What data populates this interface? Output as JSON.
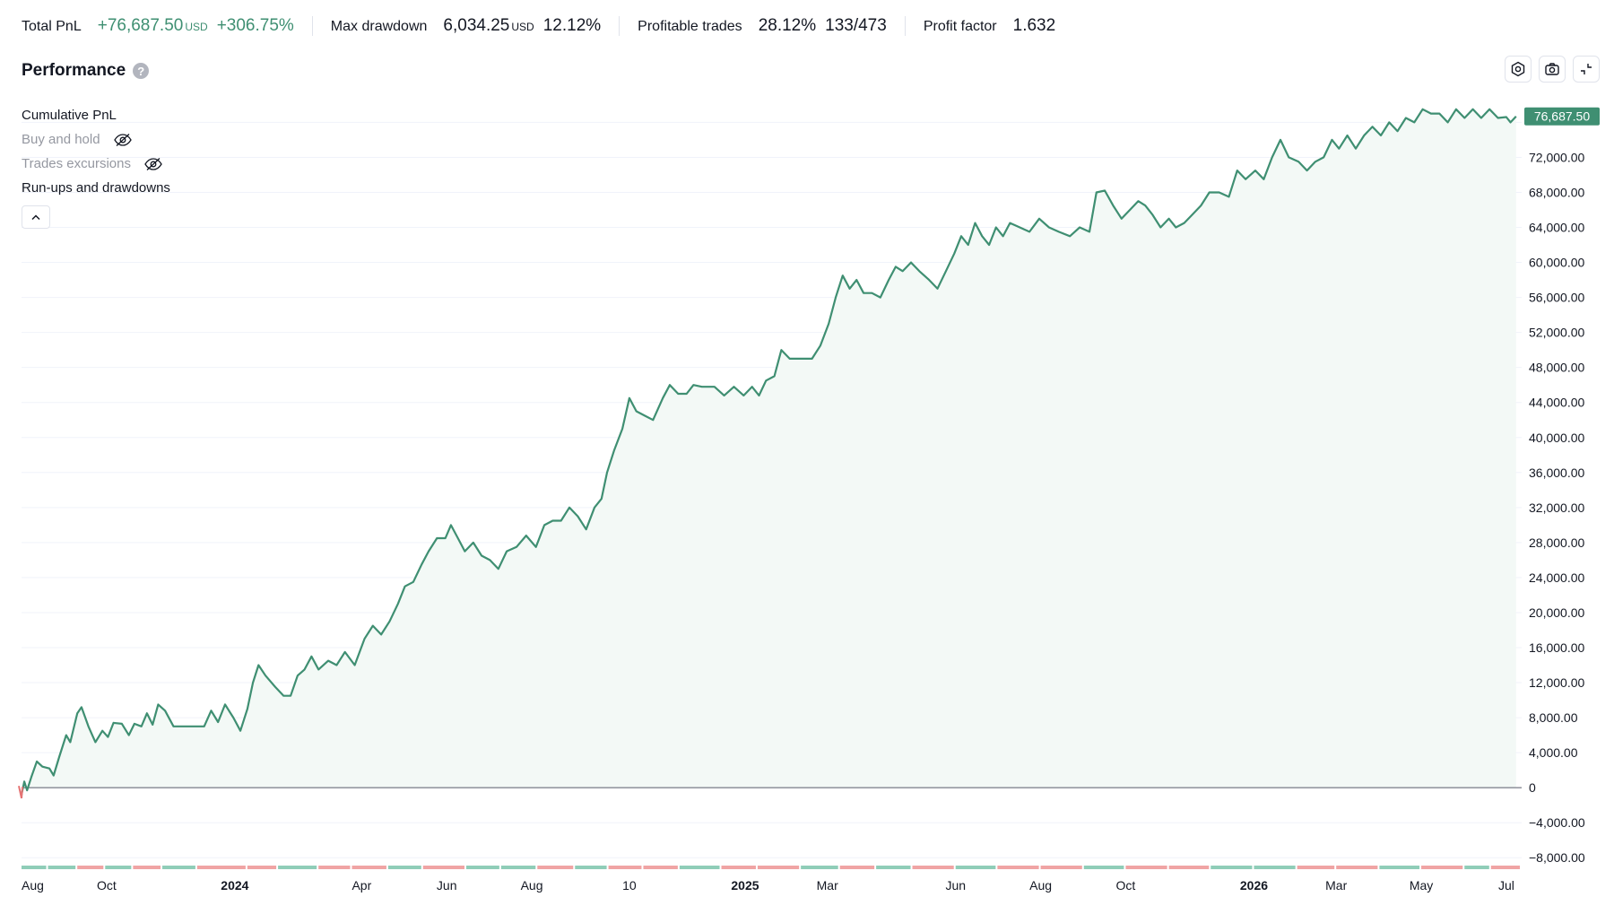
{
  "stats": {
    "total_pnl": {
      "label": "Total PnL",
      "value": "+76,687.50",
      "unit": "USD",
      "pct": "+306.75%"
    },
    "max_drawdown": {
      "label": "Max drawdown",
      "value": "6,034.25",
      "unit": "USD",
      "pct": "12.12%"
    },
    "profitable_trades": {
      "label": "Profitable trades",
      "pct": "28.12%",
      "count": "133/473"
    },
    "profit_factor": {
      "label": "Profit factor",
      "value": "1.632"
    }
  },
  "panel": {
    "title": "Performance",
    "help_icon": "question-icon",
    "toolbar_icons": [
      "settings-icon",
      "camera-icon",
      "collapse-icon"
    ]
  },
  "legend": {
    "cumulative": "Cumulative PnL",
    "buy_hold": "Buy and hold",
    "excursions": "Trades excursions",
    "runups": "Run-ups and drawdowns",
    "hidden_icon": "eye-off-icon",
    "collapse_icon": "chevron-up-icon"
  },
  "colors": {
    "accent": "#3f8f72",
    "fill": "#f3f9f6",
    "negative": "#e57373",
    "bar_green": "#8fcdb8",
    "bar_red": "#f0a4a4",
    "last_badge": "#3f8f72"
  },
  "chart_data": {
    "type": "area",
    "title": "",
    "xlabel": "",
    "ylabel": "",
    "ylim": [
      -9000,
      78500
    ],
    "grid": true,
    "y_ticks": [
      76000,
      72000,
      68000,
      64000,
      60000,
      56000,
      52000,
      48000,
      44000,
      40000,
      36000,
      32000,
      28000,
      24000,
      20000,
      16000,
      12000,
      8000,
      4000,
      0,
      -4000,
      -8000
    ],
    "y_tick_labels": [
      "76,000.00",
      "72,000.00",
      "68,000.00",
      "64,000.00",
      "60,000.00",
      "56,000.00",
      "52,000.00",
      "48,000.00",
      "44,000.00",
      "40,000.00",
      "36,000.00",
      "32,000.00",
      "28,000.00",
      "24,000.00",
      "20,000.00",
      "16,000.00",
      "12,000.00",
      "8,000.00",
      "4,000.00",
      "0",
      "−4,000.00",
      "−8,000.00"
    ],
    "x_ticks": [
      {
        "label": "Aug",
        "date": "2023-08-01",
        "bold": false
      },
      {
        "label": "Oct",
        "date": "2023-10-01",
        "bold": false
      },
      {
        "label": "2024",
        "date": "2024-01-01",
        "bold": true
      },
      {
        "label": "Apr",
        "date": "2024-04-01",
        "bold": false
      },
      {
        "label": "Jun",
        "date": "2024-06-01",
        "bold": false
      },
      {
        "label": "Aug",
        "date": "2024-08-01",
        "bold": false
      },
      {
        "label": "10",
        "date": "2024-10-10",
        "bold": false
      },
      {
        "label": "2025",
        "date": "2025-01-01",
        "bold": true
      },
      {
        "label": "Mar",
        "date": "2025-03-01",
        "bold": false
      },
      {
        "label": "Jun",
        "date": "2025-06-01",
        "bold": false
      },
      {
        "label": "Aug",
        "date": "2025-08-01",
        "bold": false
      },
      {
        "label": "Oct",
        "date": "2025-10-01",
        "bold": false
      },
      {
        "label": "2026",
        "date": "2026-01-01",
        "bold": true
      },
      {
        "label": "Mar",
        "date": "2026-03-01",
        "bold": false
      },
      {
        "label": "May",
        "date": "2026-05-01",
        "bold": false
      },
      {
        "label": "Jul",
        "date": "2026-07-01",
        "bold": false
      }
    ],
    "last_value_label": "76,687.50",
    "series": [
      {
        "name": "Cumulative PnL",
        "points": [
          [
            "2023-08-01",
            -800
          ],
          [
            "2023-08-03",
            700
          ],
          [
            "2023-08-05",
            -300
          ],
          [
            "2023-08-08",
            1200
          ],
          [
            "2023-08-12",
            3000
          ],
          [
            "2023-08-16",
            2400
          ],
          [
            "2023-08-21",
            2200
          ],
          [
            "2023-08-24",
            1400
          ],
          [
            "2023-08-28",
            3500
          ],
          [
            "2023-09-02",
            6000
          ],
          [
            "2023-09-05",
            5200
          ],
          [
            "2023-09-10",
            8500
          ],
          [
            "2023-09-13",
            9200
          ],
          [
            "2023-09-18",
            7000
          ],
          [
            "2023-09-23",
            5200
          ],
          [
            "2023-09-28",
            6500
          ],
          [
            "2023-10-02",
            5800
          ],
          [
            "2023-10-06",
            7400
          ],
          [
            "2023-10-12",
            7300
          ],
          [
            "2023-10-17",
            6000
          ],
          [
            "2023-10-21",
            7300
          ],
          [
            "2023-10-26",
            7000
          ],
          [
            "2023-10-30",
            8500
          ],
          [
            "2023-11-03",
            7200
          ],
          [
            "2023-11-07",
            9500
          ],
          [
            "2023-11-12",
            8800
          ],
          [
            "2023-11-18",
            7000
          ],
          [
            "2023-11-30",
            7000
          ],
          [
            "2023-12-10",
            7000
          ],
          [
            "2023-12-15",
            8800
          ],
          [
            "2023-12-20",
            7500
          ],
          [
            "2023-12-25",
            9500
          ],
          [
            "2023-12-31",
            8000
          ],
          [
            "2024-01-05",
            6500
          ],
          [
            "2024-01-10",
            9000
          ],
          [
            "2024-01-14",
            12000
          ],
          [
            "2024-01-18",
            14000
          ],
          [
            "2024-01-23",
            12800
          ],
          [
            "2024-01-30",
            11500
          ],
          [
            "2024-02-05",
            10500
          ],
          [
            "2024-02-10",
            10500
          ],
          [
            "2024-02-15",
            12800
          ],
          [
            "2024-02-20",
            13500
          ],
          [
            "2024-02-25",
            15000
          ],
          [
            "2024-03-01",
            13500
          ],
          [
            "2024-03-08",
            14500
          ],
          [
            "2024-03-14",
            14000
          ],
          [
            "2024-03-20",
            15500
          ],
          [
            "2024-03-27",
            14000
          ],
          [
            "2024-04-03",
            17000
          ],
          [
            "2024-04-09",
            18500
          ],
          [
            "2024-04-15",
            17500
          ],
          [
            "2024-04-21",
            19000
          ],
          [
            "2024-04-27",
            21000
          ],
          [
            "2024-05-02",
            23000
          ],
          [
            "2024-05-08",
            23500
          ],
          [
            "2024-05-14",
            25500
          ],
          [
            "2024-05-19",
            27000
          ],
          [
            "2024-05-25",
            28500
          ],
          [
            "2024-05-31",
            28500
          ],
          [
            "2024-06-04",
            30000
          ],
          [
            "2024-06-09",
            28500
          ],
          [
            "2024-06-14",
            27000
          ],
          [
            "2024-06-20",
            28000
          ],
          [
            "2024-06-26",
            26500
          ],
          [
            "2024-07-02",
            26000
          ],
          [
            "2024-07-08",
            25000
          ],
          [
            "2024-07-14",
            27000
          ],
          [
            "2024-07-21",
            27500
          ],
          [
            "2024-07-28",
            28800
          ],
          [
            "2024-08-04",
            27500
          ],
          [
            "2024-08-10",
            30000
          ],
          [
            "2024-08-16",
            30500
          ],
          [
            "2024-08-22",
            30500
          ],
          [
            "2024-08-28",
            32000
          ],
          [
            "2024-09-03",
            31000
          ],
          [
            "2024-09-09",
            29500
          ],
          [
            "2024-09-15",
            32000
          ],
          [
            "2024-09-20",
            33000
          ],
          [
            "2024-09-24",
            36000
          ],
          [
            "2024-09-29",
            38500
          ],
          [
            "2024-10-05",
            41000
          ],
          [
            "2024-10-10",
            44500
          ],
          [
            "2024-10-15",
            43000
          ],
          [
            "2024-10-21",
            42500
          ],
          [
            "2024-10-27",
            42000
          ],
          [
            "2024-11-03",
            44500
          ],
          [
            "2024-11-08",
            46000
          ],
          [
            "2024-11-14",
            45000
          ],
          [
            "2024-11-20",
            45000
          ],
          [
            "2024-11-25",
            46000
          ],
          [
            "2024-12-01",
            45800
          ],
          [
            "2024-12-10",
            45800
          ],
          [
            "2024-12-17",
            44800
          ],
          [
            "2024-12-24",
            45800
          ],
          [
            "2024-12-31",
            44800
          ],
          [
            "2025-01-06",
            45800
          ],
          [
            "2025-01-11",
            44800
          ],
          [
            "2025-01-16",
            46500
          ],
          [
            "2025-01-22",
            47000
          ],
          [
            "2025-01-27",
            50000
          ],
          [
            "2025-02-02",
            49000
          ],
          [
            "2025-02-10",
            49000
          ],
          [
            "2025-02-18",
            49000
          ],
          [
            "2025-02-24",
            50500
          ],
          [
            "2025-03-02",
            53000
          ],
          [
            "2025-03-07",
            56000
          ],
          [
            "2025-03-12",
            58500
          ],
          [
            "2025-03-17",
            57000
          ],
          [
            "2025-03-22",
            58000
          ],
          [
            "2025-03-27",
            56500
          ],
          [
            "2025-04-02",
            56500
          ],
          [
            "2025-04-08",
            56000
          ],
          [
            "2025-04-14",
            58000
          ],
          [
            "2025-04-19",
            59500
          ],
          [
            "2025-04-24",
            59000
          ],
          [
            "2025-04-30",
            60000
          ],
          [
            "2025-05-06",
            59000
          ],
          [
            "2025-05-13",
            58000
          ],
          [
            "2025-05-19",
            57000
          ],
          [
            "2025-05-25",
            59000
          ],
          [
            "2025-05-31",
            61000
          ],
          [
            "2025-06-05",
            63000
          ],
          [
            "2025-06-10",
            62000
          ],
          [
            "2025-06-15",
            64500
          ],
          [
            "2025-06-20",
            63000
          ],
          [
            "2025-06-25",
            62000
          ],
          [
            "2025-06-30",
            64000
          ],
          [
            "2025-07-05",
            63000
          ],
          [
            "2025-07-10",
            64500
          ],
          [
            "2025-07-17",
            64000
          ],
          [
            "2025-07-24",
            63500
          ],
          [
            "2025-07-31",
            65000
          ],
          [
            "2025-08-07",
            64000
          ],
          [
            "2025-08-14",
            63500
          ],
          [
            "2025-08-22",
            63000
          ],
          [
            "2025-08-29",
            64000
          ],
          [
            "2025-09-05",
            63500
          ],
          [
            "2025-09-10",
            68000
          ],
          [
            "2025-09-16",
            68200
          ],
          [
            "2025-09-22",
            66500
          ],
          [
            "2025-09-28",
            65000
          ],
          [
            "2025-10-04",
            66000
          ],
          [
            "2025-10-10",
            67000
          ],
          [
            "2025-10-15",
            66500
          ],
          [
            "2025-10-20",
            65500
          ],
          [
            "2025-10-26",
            64000
          ],
          [
            "2025-11-01",
            65000
          ],
          [
            "2025-11-06",
            64000
          ],
          [
            "2025-11-12",
            64500
          ],
          [
            "2025-11-18",
            65500
          ],
          [
            "2025-11-24",
            66500
          ],
          [
            "2025-11-30",
            68000
          ],
          [
            "2025-12-07",
            68000
          ],
          [
            "2025-12-14",
            67500
          ],
          [
            "2025-12-20",
            70500
          ],
          [
            "2025-12-26",
            69500
          ],
          [
            "2026-01-02",
            70500
          ],
          [
            "2026-01-08",
            69500
          ],
          [
            "2026-01-14",
            72000
          ],
          [
            "2026-01-20",
            74000
          ],
          [
            "2026-01-26",
            72000
          ],
          [
            "2026-02-02",
            71500
          ],
          [
            "2026-02-08",
            70500
          ],
          [
            "2026-02-14",
            71500
          ],
          [
            "2026-02-20",
            72000
          ],
          [
            "2026-02-26",
            74000
          ],
          [
            "2026-03-03",
            73000
          ],
          [
            "2026-03-09",
            74500
          ],
          [
            "2026-03-15",
            73000
          ],
          [
            "2026-03-21",
            74500
          ],
          [
            "2026-03-27",
            75500
          ],
          [
            "2026-04-02",
            74500
          ],
          [
            "2026-04-08",
            76000
          ],
          [
            "2026-04-14",
            75000
          ],
          [
            "2026-04-20",
            76500
          ],
          [
            "2026-04-26",
            76000
          ],
          [
            "2026-05-02",
            77500
          ],
          [
            "2026-05-08",
            77000
          ],
          [
            "2026-05-14",
            77000
          ],
          [
            "2026-05-20",
            76000
          ],
          [
            "2026-05-26",
            77500
          ],
          [
            "2026-06-01",
            76500
          ],
          [
            "2026-06-07",
            77500
          ],
          [
            "2026-06-13",
            76500
          ],
          [
            "2026-06-19",
            77500
          ],
          [
            "2026-06-25",
            76500
          ],
          [
            "2026-07-01",
            76600
          ],
          [
            "2026-07-04",
            76000
          ],
          [
            "2026-07-08",
            76687.5
          ]
        ]
      }
    ],
    "run_ups_drawdowns": [
      [
        "2023-08-01",
        "up"
      ],
      [
        "2023-08-20",
        "up"
      ],
      [
        "2023-09-10",
        "down"
      ],
      [
        "2023-09-30",
        "up"
      ],
      [
        "2023-10-20",
        "down"
      ],
      [
        "2023-11-10",
        "up"
      ],
      [
        "2023-12-05",
        "down"
      ],
      [
        "2024-01-10",
        "down"
      ],
      [
        "2024-02-01",
        "up"
      ],
      [
        "2024-03-01",
        "down"
      ],
      [
        "2024-03-25",
        "down"
      ],
      [
        "2024-04-20",
        "up"
      ],
      [
        "2024-05-15",
        "down"
      ],
      [
        "2024-06-15",
        "up"
      ],
      [
        "2024-07-10",
        "up"
      ],
      [
        "2024-08-05",
        "down"
      ],
      [
        "2024-09-01",
        "up"
      ],
      [
        "2024-09-25",
        "down"
      ],
      [
        "2024-10-20",
        "down"
      ],
      [
        "2024-11-15",
        "up"
      ],
      [
        "2024-12-15",
        "down"
      ],
      [
        "2025-01-10",
        "down"
      ],
      [
        "2025-02-10",
        "up"
      ],
      [
        "2025-03-10",
        "down"
      ],
      [
        "2025-04-05",
        "up"
      ],
      [
        "2025-05-01",
        "down"
      ],
      [
        "2025-06-01",
        "up"
      ],
      [
        "2025-07-01",
        "down"
      ],
      [
        "2025-08-01",
        "down"
      ],
      [
        "2025-09-01",
        "up"
      ],
      [
        "2025-10-01",
        "down"
      ],
      [
        "2025-11-01",
        "down"
      ],
      [
        "2025-12-01",
        "up"
      ],
      [
        "2026-01-01",
        "up"
      ],
      [
        "2026-02-01",
        "down"
      ],
      [
        "2026-03-01",
        "down"
      ],
      [
        "2026-04-01",
        "up"
      ],
      [
        "2026-05-01",
        "down"
      ],
      [
        "2026-06-01",
        "up"
      ],
      [
        "2026-06-20",
        "down"
      ]
    ]
  }
}
